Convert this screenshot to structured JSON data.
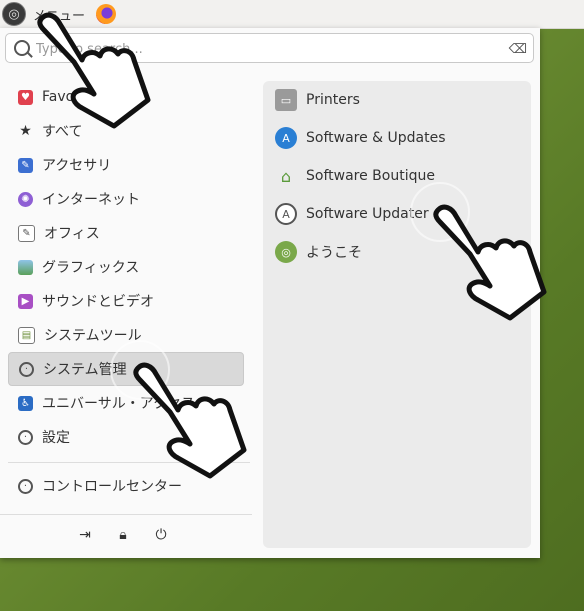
{
  "panel": {
    "menu_label": "メニュー",
    "menu_icon": "ubuntu-logo-icon",
    "launcher": "firefox-icon"
  },
  "search": {
    "placeholder": "Type to search...",
    "value": ""
  },
  "categories": [
    {
      "label": "Favorites",
      "icon": "heart-icon",
      "color": "#e0414e"
    },
    {
      "label": "すべて",
      "icon": "star-icon",
      "color": "#333333"
    },
    {
      "label": "アクセサリ",
      "icon": "accessories-icon",
      "color": "#3c6fd1"
    },
    {
      "label": "インターネット",
      "icon": "internet-icon",
      "color": "#8e5fd4"
    },
    {
      "label": "オフィス",
      "icon": "office-icon",
      "color": "#777777"
    },
    {
      "label": "グラフィックス",
      "icon": "graphics-icon",
      "color": "#5aa05a"
    },
    {
      "label": "サウンドとビデオ",
      "icon": "multimedia-icon",
      "color": "#a84fc4"
    },
    {
      "label": "システムツール",
      "icon": "system-tools-icon",
      "color": "#6c8f3a"
    },
    {
      "label": "システム管理",
      "icon": "administration-icon",
      "color": "#555555",
      "active": true
    },
    {
      "label": "ユニバーサル・アクセス",
      "icon": "accessibility-icon",
      "color": "#2b6cc4"
    },
    {
      "label": "設定",
      "icon": "settings-icon",
      "color": "#555555"
    }
  ],
  "control_center": {
    "label": "コントロールセンター",
    "icon": "control-center-icon"
  },
  "bottom_actions": [
    {
      "name": "logout-icon"
    },
    {
      "name": "lock-icon"
    },
    {
      "name": "power-icon"
    }
  ],
  "apps": [
    {
      "label": "Printers",
      "icon": "printer-icon",
      "color": "#888888"
    },
    {
      "label": "Software & Updates",
      "icon": "software-updates-icon",
      "color": "#2a7fd4"
    },
    {
      "label": "Software Boutique",
      "icon": "boutique-icon",
      "color": "#5a9a3a"
    },
    {
      "label": "Software Updater",
      "icon": "updater-icon",
      "color": "#555555"
    },
    {
      "label": "ようこそ",
      "icon": "welcome-icon",
      "color": "#7aa84a"
    }
  ]
}
